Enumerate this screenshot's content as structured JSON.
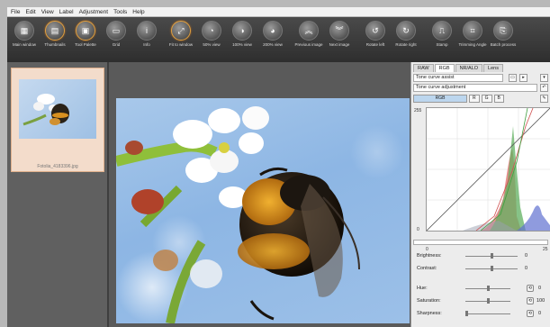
{
  "menu": [
    "File",
    "Edit",
    "View",
    "Label",
    "Adjustment",
    "Tools",
    "Help"
  ],
  "toolbar": [
    {
      "label": "Main window",
      "icon": "grid-icon"
    },
    {
      "label": "Thumbnails",
      "icon": "thumbnails-icon"
    },
    {
      "label": "Tool Palette",
      "icon": "palette-icon"
    },
    {
      "label": "Grid",
      "icon": "grid-icon"
    },
    {
      "label": "Info",
      "icon": "info-icon"
    },
    {
      "label": "Fit to window",
      "icon": "fit-icon"
    },
    {
      "label": "50% view",
      "icon": "zoom-icon"
    },
    {
      "label": "100% view",
      "icon": "zoom-icon"
    },
    {
      "label": "200% view",
      "icon": "zoom-icon"
    },
    {
      "label": "Previous image",
      "icon": "chevron-up-icon"
    },
    {
      "label": "Next image",
      "icon": "chevron-down-icon"
    },
    {
      "label": "Rotate left",
      "icon": "rotate-left-icon"
    },
    {
      "label": "Rotate right",
      "icon": "rotate-right-icon"
    },
    {
      "label": "Stamp",
      "icon": "stamp-icon"
    },
    {
      "label": "Trimming Angle",
      "icon": "trim-icon"
    },
    {
      "label": "Batch process",
      "icon": "batch-icon"
    }
  ],
  "thumbnail": {
    "name": "Fotolia_4183396.jpg"
  },
  "panel": {
    "tabs": [
      "RAW",
      "RGB",
      "NR/ALO",
      "Lens"
    ],
    "active_tab": "RGB",
    "tone_assist": "Tone curve assist",
    "tone_adjust": "Tone curve adjustment",
    "channels": [
      "RGB",
      "R",
      "G",
      "B"
    ],
    "graph_top": "255",
    "graph_bottom": "0",
    "scale_left": "0",
    "scale_right": "25",
    "sliders": [
      {
        "label": "Brightness:",
        "value": "0",
        "pos": 0.5
      },
      {
        "label": "Contrast:",
        "value": "0",
        "pos": 0.5
      },
      {
        "label": "Hue:",
        "value": "0",
        "pos": 0.5
      },
      {
        "label": "Saturation:",
        "value": "100",
        "pos": 0.5
      },
      {
        "label": "Sharpness:",
        "value": "0",
        "pos": 0.0
      }
    ]
  }
}
